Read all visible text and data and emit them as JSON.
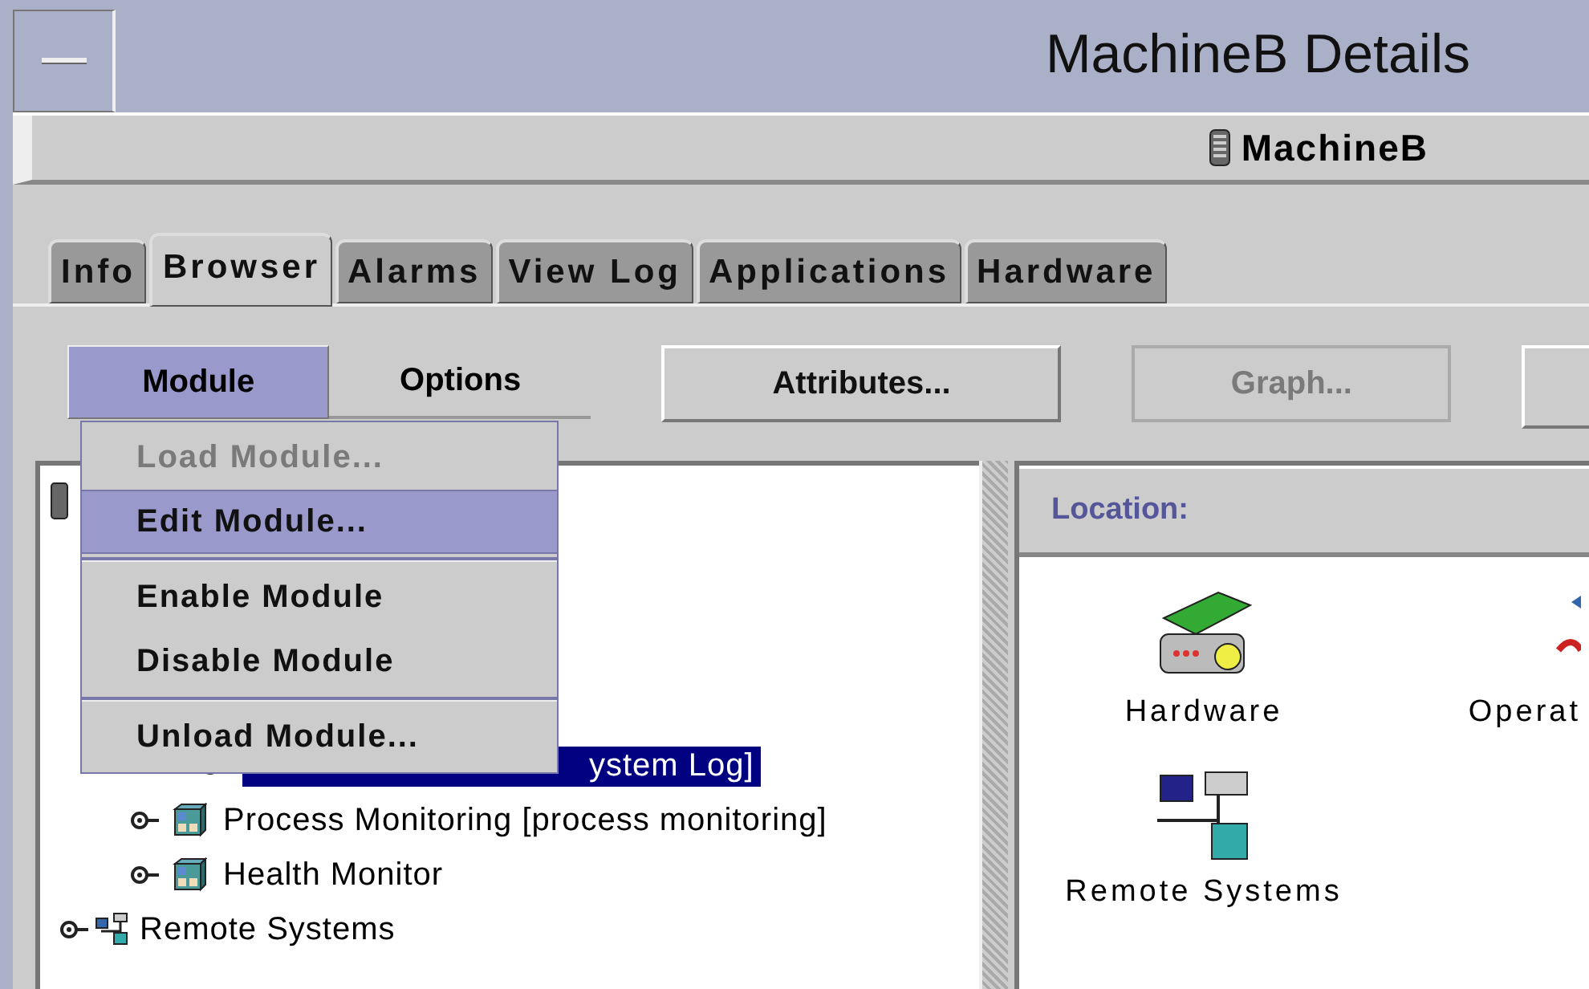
{
  "window": {
    "title": "MachineB Details"
  },
  "host": {
    "name": "MachineB"
  },
  "tabs": [
    {
      "label": "Info",
      "selected": false
    },
    {
      "label": "Browser",
      "selected": true
    },
    {
      "label": "Alarms",
      "selected": false
    },
    {
      "label": "View Log",
      "selected": false
    },
    {
      "label": "Applications",
      "selected": false
    },
    {
      "label": "Hardware",
      "selected": false
    }
  ],
  "menubar": [
    {
      "label": "Module",
      "selected": true
    },
    {
      "label": "Options",
      "selected": false
    }
  ],
  "toolbar": [
    {
      "label": "Attributes...",
      "disabled": false
    },
    {
      "label": "Graph...",
      "disabled": true
    }
  ],
  "menu": {
    "items": [
      {
        "kind": "item",
        "label": "Load Module...",
        "disabled": true,
        "selected": false
      },
      {
        "kind": "item",
        "label": "Edit Module...",
        "disabled": false,
        "selected": true
      },
      {
        "kind": "separator"
      },
      {
        "kind": "item",
        "label": "Enable Module",
        "disabled": false,
        "selected": false
      },
      {
        "kind": "item",
        "label": "Disable Module",
        "disabled": false,
        "selected": false
      },
      {
        "kind": "separator"
      },
      {
        "kind": "item",
        "label": "Unload Module...",
        "disabled": false,
        "selected": false
      }
    ]
  },
  "tree": {
    "items": [
      {
        "kind": "module",
        "label": "ystem Log]",
        "selected": true
      },
      {
        "kind": "module",
        "label": "Process Monitoring [process monitoring]",
        "selected": false
      },
      {
        "kind": "module",
        "label": "Health Monitor",
        "selected": false
      },
      {
        "kind": "remote",
        "label": "Remote Systems",
        "selected": false
      }
    ]
  },
  "location": {
    "label": "Location:"
  },
  "objects": [
    {
      "kind": "hardware",
      "label": "Hardware"
    },
    {
      "kind": "os",
      "label": "Operat"
    },
    {
      "kind": "remote",
      "label": "Remote Systems"
    }
  ]
}
